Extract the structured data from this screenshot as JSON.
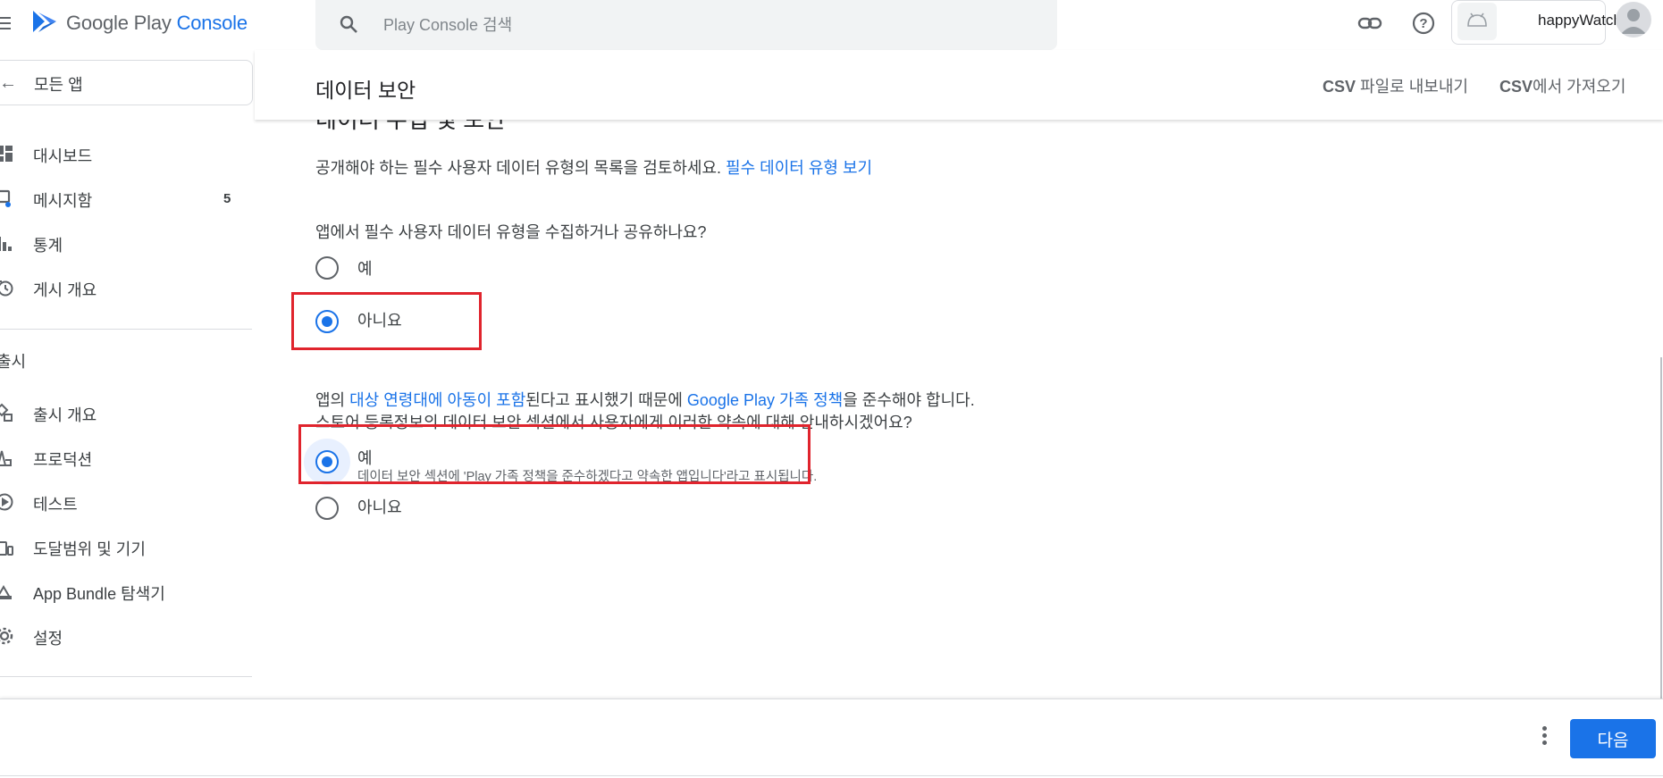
{
  "app": {
    "brand_google_play": "Google Play ",
    "brand_console": "Console"
  },
  "search": {
    "placeholder": "Play Console 검색"
  },
  "account": {
    "app_name": "happyWatch"
  },
  "sidebar": {
    "all_apps": "모든 앱",
    "items": [
      {
        "label": "대시보드",
        "icon": "dashboard-icon"
      },
      {
        "label": "메시지함",
        "icon": "inbox-icon",
        "badge": "5"
      },
      {
        "label": "통계",
        "icon": "bar-chart-icon"
      },
      {
        "label": "게시 개요",
        "icon": "publishing-clock-icon"
      }
    ],
    "section_release": "출시",
    "release_items": [
      {
        "label": "출시 개요",
        "icon": "release-overview-icon"
      },
      {
        "label": "프로덕션",
        "icon": "production-icon"
      },
      {
        "label": "테스트",
        "icon": "testing-icon"
      },
      {
        "label": "도달범위 및 기기",
        "icon": "reach-devices-icon"
      },
      {
        "label": "App Bundle 탐색기",
        "icon": "bundle-explorer-icon"
      },
      {
        "label": "설정",
        "icon": "gear-icon"
      }
    ]
  },
  "header": {
    "title": "데이터 보안",
    "export_csv_bold": "CSV",
    "export_csv_rest": " 파일로 내보내기",
    "import_csv_bold": "CSV",
    "import_csv_rest": "에서 가져오기"
  },
  "content": {
    "clipped_heading": "데이터 수집 및 보안",
    "intro_text": "공개해야 하는 필수 사용자 데이터 유형의 목록을 검토하세요. ",
    "intro_link": "필수 데이터 유형 보기",
    "question1": "앱에서 필수 사용자 데이터 유형을 수집하거나 공유하나요?",
    "q1_yes": "예",
    "q1_no": "아니요",
    "q1_selected": "no",
    "policy_pre": "앱의 ",
    "policy_link1": "대상 연령대에 아동이 포함",
    "policy_mid": "된다고 표시했기 때문에 ",
    "policy_link2": "Google Play 가족 정책",
    "policy_post": "을 준수해야 합니다.",
    "policy_line2": "스토어 등록정보의 데이터 보안 섹션에서 사용자에게 이러한 약속에 대해 안내하시겠어요?",
    "q2_yes": "예",
    "q2_yes_sub": "데이터 보안 섹션에 'Play 가족 정책을 준수하겠다고 약속한 앱입니다'라고 표시됩니다.",
    "q2_no": "아니요",
    "q2_selected": "yes"
  },
  "footer": {
    "next_label": "다음"
  },
  "colors": {
    "accent": "#1a73e8",
    "highlight": "#e0242d"
  }
}
